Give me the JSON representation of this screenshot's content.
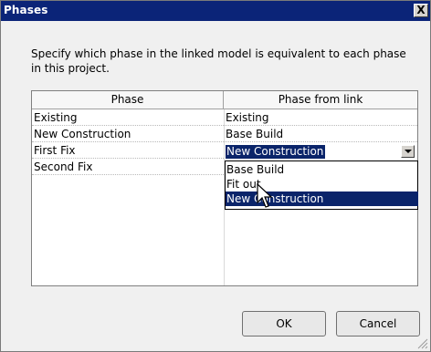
{
  "dialog": {
    "title": "Phases",
    "close_glyph": "X",
    "instruction": "Specify which phase in the linked model is equivalent to each phase in this project."
  },
  "table": {
    "headers": {
      "phase": "Phase",
      "link": "Phase from link"
    },
    "rows": [
      {
        "phase": "Existing",
        "link": "Existing"
      },
      {
        "phase": "New Construction",
        "link": "Base Build"
      },
      {
        "phase": "First Fix",
        "link": "New Construction"
      },
      {
        "phase": "Second Fix",
        "link": ""
      }
    ]
  },
  "dropdown": {
    "selected_value": "New Construction",
    "options": [
      "Base Build",
      "Fit out",
      "New Construction"
    ],
    "highlighted_option": "New Construction"
  },
  "buttons": {
    "ok": "OK",
    "cancel": "Cancel"
  },
  "colors": {
    "titlebar": "#0b2478",
    "selection": "#0a246a",
    "window_bg": "#f0f0f0"
  },
  "icons": {
    "close": "close-icon",
    "dropdown_arrow": "chevron-down-icon",
    "cursor": "pointer-cursor-icon",
    "resize": "resize-grip-icon"
  }
}
